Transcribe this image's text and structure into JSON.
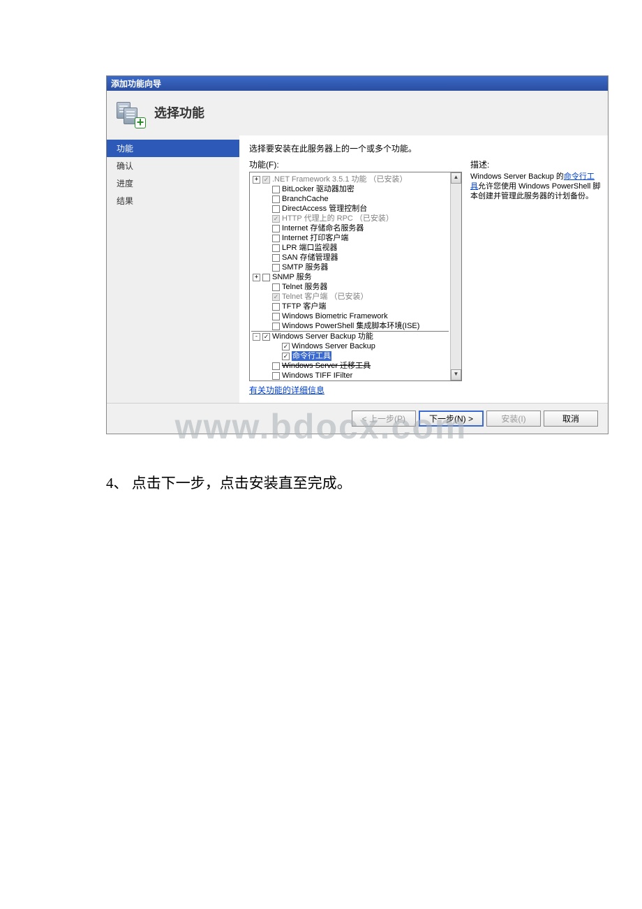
{
  "wizard": {
    "title": "添加功能向导",
    "header_title": "选择功能",
    "sidebar": [
      {
        "label": "功能",
        "active": true
      },
      {
        "label": "确认",
        "active": false
      },
      {
        "label": "进度",
        "active": false
      },
      {
        "label": "结果",
        "active": false
      }
    ],
    "instruction": "选择要安装在此服务器上的一个或多个功能。",
    "features_label": "功能(F):",
    "description_label": "描述:",
    "description": {
      "pre": "Windows Server Backup 的",
      "link": "命令行工具",
      "post": "允许您使用 Windows PowerShell 脚本创建并管理此服务器的计划备份。"
    },
    "details_link": "有关功能的详细信息",
    "tree": [
      {
        "indent": 0,
        "expander": "+",
        "cb": "checked-disabled",
        "label": ".NET Framework 3.5.1 功能",
        "suffix": "（已安装）",
        "disabled": true
      },
      {
        "indent": 1,
        "expander": "",
        "cb": "unchecked",
        "label": "BitLocker 驱动器加密"
      },
      {
        "indent": 1,
        "expander": "",
        "cb": "unchecked",
        "label": "BranchCache"
      },
      {
        "indent": 1,
        "expander": "",
        "cb": "unchecked",
        "label": "DirectAccess 管理控制台"
      },
      {
        "indent": 1,
        "expander": "",
        "cb": "checked-disabled",
        "label": "HTTP 代理上的 RPC",
        "suffix": "（已安装）",
        "disabled": true
      },
      {
        "indent": 1,
        "expander": "",
        "cb": "unchecked",
        "label": "Internet 存储命名服务器"
      },
      {
        "indent": 1,
        "expander": "",
        "cb": "unchecked",
        "label": "Internet 打印客户端"
      },
      {
        "indent": 1,
        "expander": "",
        "cb": "unchecked",
        "label": "LPR 端口监视器"
      },
      {
        "indent": 1,
        "expander": "",
        "cb": "unchecked",
        "label": "SAN 存储管理器"
      },
      {
        "indent": 1,
        "expander": "",
        "cb": "unchecked",
        "label": "SMTP 服务器"
      },
      {
        "indent": 0,
        "expander": "+",
        "cb": "unchecked",
        "label": "SNMP 服务"
      },
      {
        "indent": 1,
        "expander": "",
        "cb": "unchecked",
        "label": "Telnet 服务器"
      },
      {
        "indent": 1,
        "expander": "",
        "cb": "checked-disabled",
        "label": "Telnet 客户端",
        "suffix": "（已安装）",
        "disabled": true
      },
      {
        "indent": 1,
        "expander": "",
        "cb": "unchecked",
        "label": "TFTP 客户端"
      },
      {
        "indent": 1,
        "expander": "",
        "cb": "unchecked",
        "label": "Windows Biometric Framework"
      },
      {
        "indent": 1,
        "expander": "",
        "cb": "unchecked",
        "label": "Windows PowerShell 集成脚本环境(ISE)",
        "cutoff": true
      },
      {
        "indent": 0,
        "expander": "-",
        "cb": "checked",
        "label": "Windows Server Backup 功能"
      },
      {
        "indent": 2,
        "expander": "",
        "cb": "checked",
        "label": "Windows Server Backup"
      },
      {
        "indent": 2,
        "expander": "",
        "cb": "checked",
        "label": "命令行工具",
        "highlight": true
      },
      {
        "indent": 1,
        "expander": "",
        "cb": "unchecked",
        "label": "Windows Server 迁移工具",
        "strike": true
      },
      {
        "indent": 1,
        "expander": "",
        "cb": "unchecked",
        "label": "Windows TIFF IFilter"
      }
    ],
    "buttons": {
      "prev": "< 上一步(P)",
      "next": "下一步(N) >",
      "install": "安装(I)",
      "cancel": "取消"
    }
  },
  "watermark": "www.bdocx.com",
  "caption": "4、 点击下一步，点击安装直至完成。"
}
